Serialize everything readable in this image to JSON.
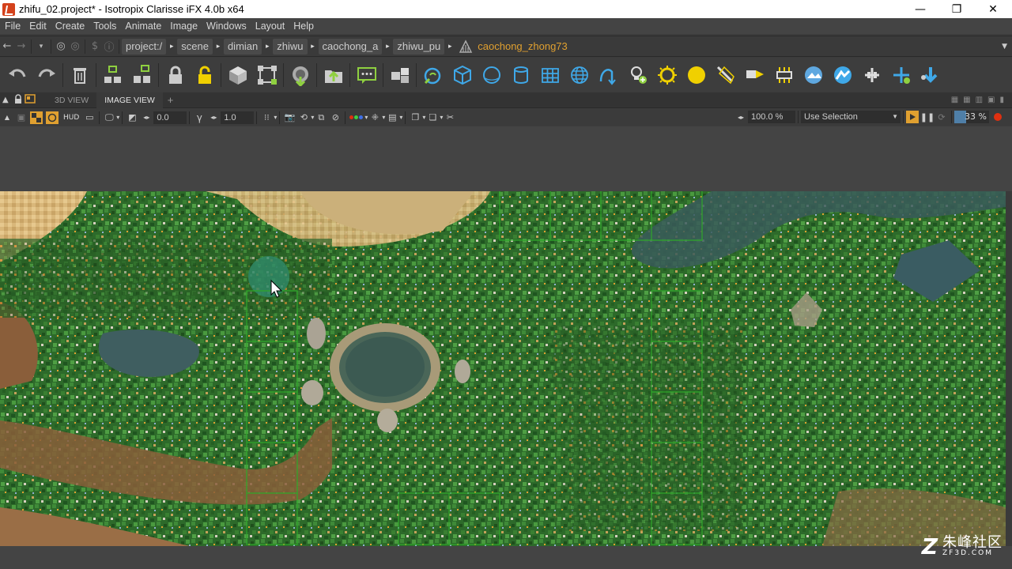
{
  "window": {
    "title": "zhifu_02.project* - Isotropix Clarisse iFX 4.0b x64",
    "controls": [
      "—",
      "❐",
      "✕"
    ]
  },
  "menu": {
    "items": [
      "File",
      "Edit",
      "Create",
      "Tools",
      "Animate",
      "Image",
      "Windows",
      "Layout",
      "Help"
    ]
  },
  "pathbar": {
    "crumbs": [
      "project:/",
      "scene",
      "dimian",
      "zhiwu",
      "caochong_a",
      "zhiwu_pu"
    ],
    "active": "caochong_zhong73",
    "arrow": "▸",
    "nav": [
      "←",
      "→",
      "▾",
      "◎",
      "◎",
      "$",
      "ⓘ"
    ]
  },
  "toolbar": {
    "icons": [
      "undo-icon",
      "redo-icon",
      "delete-icon",
      "group-icon",
      "ungroup-icon",
      "lock-icon",
      "unlock-icon",
      "box-icon",
      "transform-icon",
      "import-icon",
      "export-icon",
      "comment-icon",
      "context-icon",
      "find-icon",
      "cube-icon",
      "sphere-icon",
      "cylinder-icon",
      "grid-icon",
      "globe-icon",
      "curve-icon",
      "light-bulb-icon",
      "sun-icon",
      "yellow-light-icon",
      "spot-light-icon",
      "directional-light-icon",
      "area-light-icon",
      "environment-icon",
      "physical-sky-icon",
      "add-icon",
      "add-cross-icon",
      "arrow-down-icon"
    ]
  },
  "tabs": {
    "items": [
      "3D VIEW",
      "IMAGE VIEW"
    ],
    "active_index": 1,
    "add": "+"
  },
  "viewbar": {
    "hud_label": "HUD",
    "gamma_symbol": "γ",
    "exposure": "0.0",
    "gamma": "1.0",
    "zoom": "100.0 %",
    "selection_mode": "Use Selection",
    "progress": "33 %"
  },
  "watermark": {
    "logo": "Z",
    "text_cn": "朱峰社区",
    "url": "ZF3D.COM"
  },
  "colors": {
    "accent": "#e0a030",
    "toolbar_blue": "#3fa8e8",
    "light_yellow": "#f0d000",
    "record_red": "#e03010"
  }
}
